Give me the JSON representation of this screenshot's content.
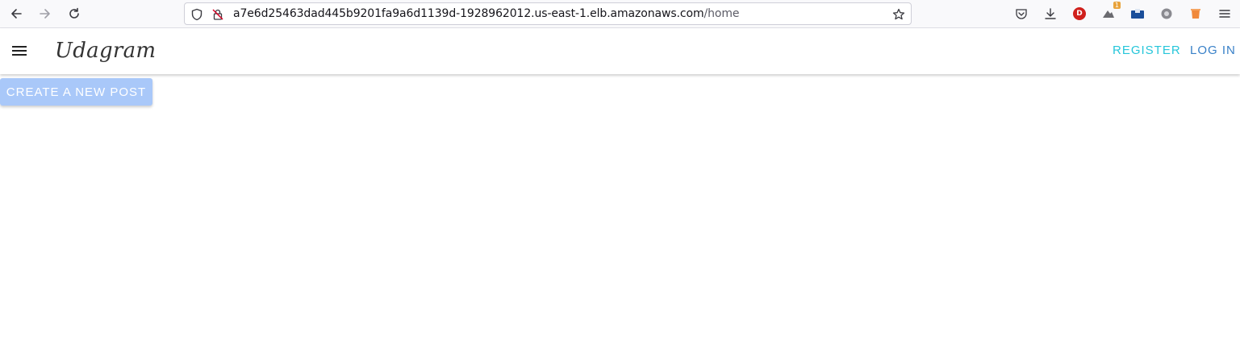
{
  "browser": {
    "url_host": "a7e6d25463dad445b9201fa9a6d1139d-1928962012.us-east-1.elb.amazonaws.com",
    "url_path": "/home",
    "extension_badge_count": "1",
    "extension_avatar_letter": "D",
    "icons": [
      "back-icon",
      "forward-icon",
      "reload-icon",
      "shield-icon",
      "insecure-lock-icon",
      "bookmark-star-icon",
      "pocket-icon",
      "downloads-icon",
      "extension-d-icon",
      "extension-notification-icon",
      "extension-translate-icon",
      "extension-gray-icon",
      "extension-orange-icon",
      "menu-icon"
    ]
  },
  "app": {
    "brand": "Udagram",
    "nav": {
      "register": "REGISTER",
      "login": "LOG IN"
    },
    "create_post_label": "CREATE A NEW POST"
  },
  "colors": {
    "register": "#26c6da",
    "login": "#3880c8",
    "create_button_bg": "#a9c8f9"
  }
}
